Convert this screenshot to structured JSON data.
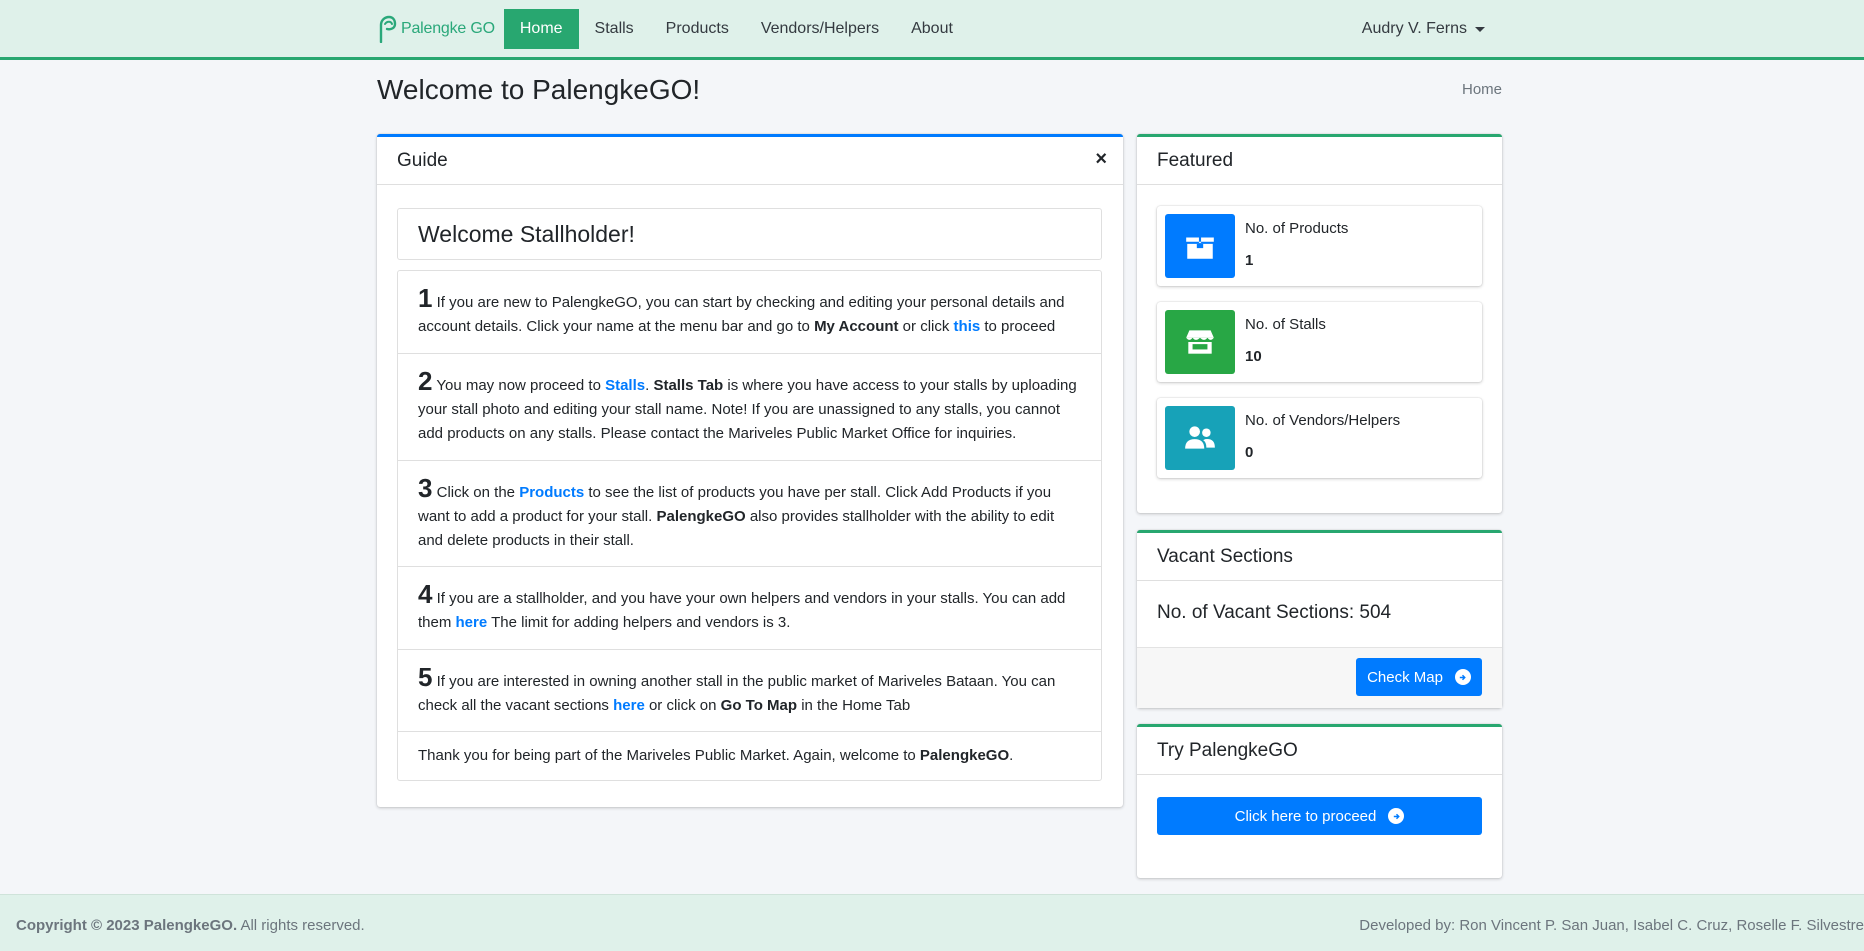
{
  "navbar": {
    "brand": "Palengke GO",
    "links": [
      "Home",
      "Stalls",
      "Products",
      "Vendors/Helpers",
      "About"
    ],
    "user": "Audry V. Ferns"
  },
  "header": {
    "title": "Welcome to PalengkeGO!",
    "breadcrumb": "Home"
  },
  "guide": {
    "title": "Guide",
    "close": "×",
    "welcome": "Welcome Stallholder!",
    "steps": [
      {
        "num": "1",
        "t1": " If you are new to PalengkeGO, you can start by checking and editing your personal details and account details. Click your name at the menu bar and go to ",
        "b1": "My Account",
        "t2": " or click ",
        "link": "this",
        "t3": " to proceed"
      },
      {
        "num": "2",
        "t1": " You may now proceed to ",
        "link": "Stalls",
        "t2": ". ",
        "b1": "Stalls Tab",
        "t3": " is where you have access to your stalls by uploading your stall photo and editing your stall name. Note! If you are unassigned to any stalls, you cannot add products on any stalls. Please contact the Mariveles Public Market Office for inquiries."
      },
      {
        "num": "3",
        "t1": " Click on the ",
        "link": "Products",
        "t2": " to see the list of products you have per stall. Click Add Products if you want to add a product for your stall. ",
        "b1": "PalengkeGO",
        "t3": " also provides stallholder with the ability to edit and delete products in their stall."
      },
      {
        "num": "4",
        "t1": " If you are a stallholder, and you have your own helpers and vendors in your stalls. You can add them ",
        "link": "here",
        "t2": " The limit for adding helpers and vendors is 3."
      },
      {
        "num": "5",
        "t1": " If you are interested in owning another stall in the public market of Mariveles Bataan. You can check all the vacant sections ",
        "link": "here",
        "t2": " or click on ",
        "b1": "Go To Map",
        "t3": " in the Home Tab"
      }
    ],
    "thanks": {
      "t1": "Thank you for being part of the Mariveles Public Market. Again, welcome to ",
      "b1": "PalengkeGO",
      "t2": "."
    }
  },
  "featured": {
    "title": "Featured",
    "boxes": [
      {
        "label": "No. of Products",
        "value": "1",
        "color": "#007bff",
        "icon": "box-icon"
      },
      {
        "label": "No. of Stalls",
        "value": "10",
        "color": "#28a745",
        "icon": "store-icon"
      },
      {
        "label": "No. of Vendors/Helpers",
        "value": "0",
        "color": "#17a2b8",
        "icon": "users-icon"
      }
    ]
  },
  "vacant": {
    "title": "Vacant Sections",
    "text": "No. of Vacant Sections: 504",
    "button": "Check Map"
  },
  "try": {
    "title": "Try PalengkeGO",
    "button": "Click here to proceed"
  },
  "footer": {
    "copyright_bold": "Copyright © 2023 PalengkeGO.",
    "copyright_rest": " All rights reserved.",
    "developers": "Developed by: Ron Vincent P. San Juan, Isabel C. Cruz, Roselle F. Silvestre"
  }
}
